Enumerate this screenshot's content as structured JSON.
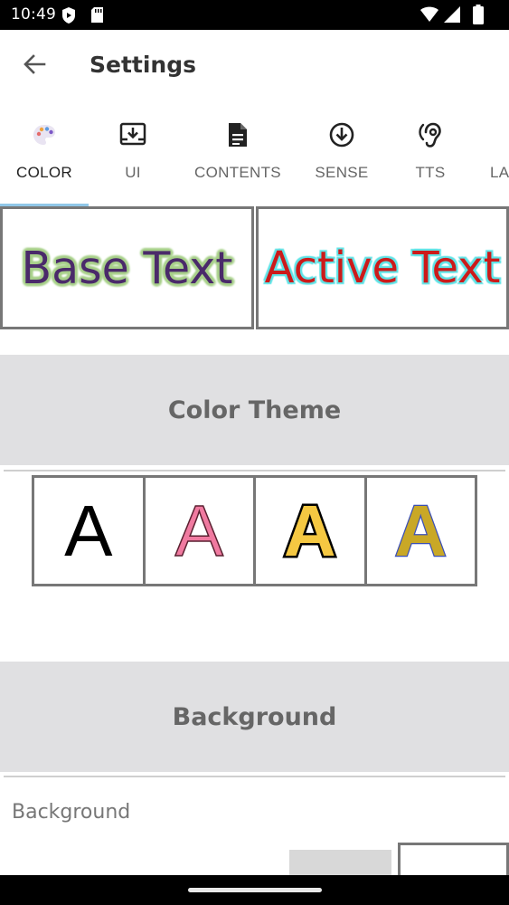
{
  "status_bar": {
    "time": "10:49",
    "icons": [
      "shield-play-icon",
      "sd-card-icon",
      "wifi-icon",
      "signal-icon",
      "battery-icon"
    ]
  },
  "app_bar": {
    "back_icon": "arrow-back-icon",
    "title": "Settings"
  },
  "tabs": [
    {
      "label": "COLOR",
      "icon": "palette-icon",
      "active": true
    },
    {
      "label": "UI",
      "icon": "download-box-icon",
      "active": false
    },
    {
      "label": "CONTENTS",
      "icon": "document-icon",
      "active": false
    },
    {
      "label": "SENSE",
      "icon": "arrow-circle-down-icon",
      "active": false
    },
    {
      "label": "TTS",
      "icon": "hearing-icon",
      "active": false
    },
    {
      "label": "LA",
      "icon": "",
      "active": false
    }
  ],
  "preview": {
    "base_text": "Base Text",
    "active_text": "Active Text",
    "colors": {
      "base_fill": "#4a2a6a",
      "base_outline": "#a8d08a",
      "active_fill": "#cc1a1a",
      "active_outline": "#5fe3e6"
    }
  },
  "color_theme": {
    "header": "Color Theme",
    "themes": [
      {
        "letter": "A",
        "fill": "#000000",
        "outline": "none"
      },
      {
        "letter": "A",
        "fill": "#f07aa0",
        "outline": "#5a2030"
      },
      {
        "letter": "A",
        "fill": "#f5c842",
        "outline": "#000000"
      },
      {
        "letter": "A",
        "fill": "#c9a826",
        "outline": "#3a4fb8"
      }
    ]
  },
  "background": {
    "header": "Background",
    "label": "Background"
  },
  "colors": {
    "accent_indicator": "#90c7e8",
    "section_bg": "#e0e0e2",
    "border": "#777777"
  }
}
